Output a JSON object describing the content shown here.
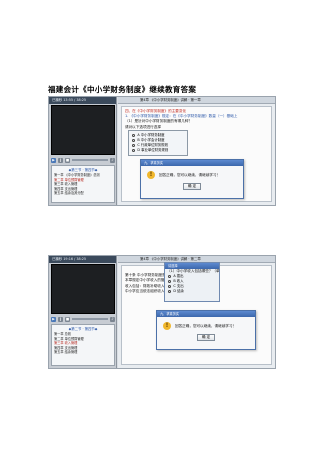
{
  "document": {
    "title": "福建会计《中小学财务制度》继续教育答案"
  },
  "screenshot1": {
    "player": {
      "time": "已播秒 13:55 / 38:25",
      "list_head": "◆第三节 · 第四节◆",
      "list_items": [
        "第一章 《中小学财务制度》总则",
        "第二章 单位预算管理",
        "第三章 收入管理",
        "第四章 支出管理",
        "第五章 结余及其分配"
      ]
    },
    "content": {
      "bar": "第4章 《中小学财务制度》讲解 · 第一章",
      "lines": [
        "四、在《中小学财务制度》的主要变化",
        "1. 《中小学财务制度》规定：在《中小学财务制度》数量（一）基础上",
        "（1）是针对中小学财务制度的有哪几种？",
        "请对以下选项进行选择"
      ],
      "options": [
        "A 中小学财务制度",
        "B 中小学会计制度",
        "C 行政单位财务规则",
        "D 事业单位财务规则"
      ],
      "dialog": {
        "title": "九、求真务实",
        "message": "回答正确，您可以继续，请继续学习！",
        "ok_label": "确 定"
      }
    }
  },
  "screenshot2": {
    "player": {
      "time": "已播秒 19:16 / 38:25",
      "list_head": "◆第二节 · 第四节◆",
      "list_items": [
        "第一章 总则",
        "第二章 单位预算管理",
        "第三章 收入管理",
        "第四章 支出管理",
        "第五章 结余管理"
      ]
    },
    "content": {
      "bar": "第4章 《中小学财务制度》讲解 · 第二章",
      "lines": [
        "第三章  收入管理",
        "第十条 中小学财务制度是指中小学依法取得的非偿还性资金",
        "本章规定中小学收入的管理、组织、规划",
        "收入包括：财政补助收入",
        "中小学应当依法组织收入"
      ],
      "inner_title": "请选择",
      "inner_question": "（1）中小学收入包括哪些？（单选）",
      "options": [
        "A 拨出",
        "B 收入",
        "C 支出",
        "D 结余"
      ],
      "dialog": {
        "title": "九、求真务实",
        "message": "回答正确，您可以继续，请继续学习！",
        "ok_label": "确 定"
      }
    }
  }
}
